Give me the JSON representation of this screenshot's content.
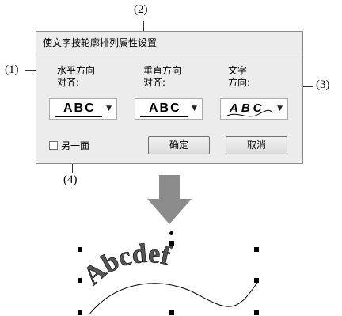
{
  "callouts": {
    "c1": "(1)",
    "c2": "(2)",
    "c3": "(3)",
    "c4": "(4)"
  },
  "dialog": {
    "title": "使文字按轮廓排列属性设置",
    "horizontal_label": "水平方向\n对齐:",
    "vertical_label": "垂直方向\n对齐:",
    "direction_label": "文字\n方向:",
    "combo1_value": "ABC",
    "combo2_value": "ABC",
    "combo3_value": "ABC",
    "other_side_label": "另一面",
    "ok_label": "确定",
    "cancel_label": "取消"
  },
  "preview": {
    "text": "Abcdef"
  },
  "colors": {
    "arrow": "#8c8c8c",
    "dialog_bg": "#ececec"
  }
}
